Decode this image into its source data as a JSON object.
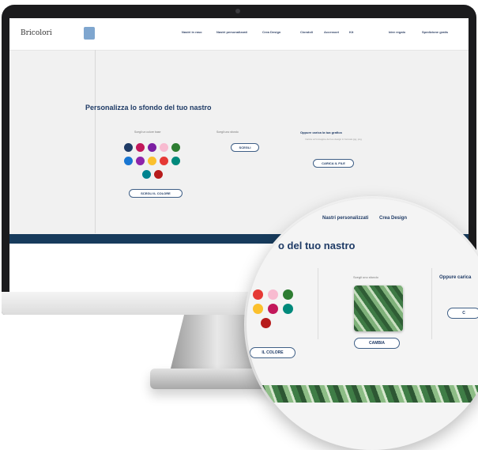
{
  "site": {
    "logo_text": "Bricolori",
    "nav": [
      {
        "label": "Nastri in raso"
      },
      {
        "label": "Nastri personalizzati"
      },
      {
        "label": "Crea Design"
      },
      {
        "label": "Ciondoli"
      },
      {
        "label": "Accessori"
      },
      {
        "label": "Kit"
      },
      {
        "label": "Idee regalo"
      },
      {
        "label": "Spedizione gratis"
      }
    ],
    "section_title": "Personalizza lo sfondo del tuo nastro",
    "col1_label": "Scegli un colore base",
    "col2_label": "Scegli uno sfondo",
    "col3_title": "Oppure carica la tua grafica",
    "col3_note": "Carica un'immagine del tuo design in formato jpg, png",
    "palette": [
      "#1f3b66",
      "#c2185b",
      "#7b1fa2",
      "#f8bbd0",
      "#2e7d32",
      "#1976d2",
      "#8e24aa",
      "#fbc02d",
      "#e53935",
      "#00897b",
      "#00838f",
      "#b71c1c"
    ],
    "button_colore": "SCEGLI IL COLORE",
    "button_sfondo": "SCEGLI",
    "button_carica": "CARICA IL FILE"
  },
  "magnifier": {
    "title_fragment": "o del tuo nastro",
    "nav_fragment_1": "Nastri personalizzati",
    "nav_fragment_2": "Crea Design",
    "col2_label": "Scegli uno sfondo",
    "col3_title": "Oppure carica",
    "palette": [
      "#e53935",
      "#f8bbd0",
      "#2e7d32",
      "#fbc02d",
      "#c2185b",
      "#00897b",
      "#b71c1c"
    ],
    "button_colore": "IL COLORE",
    "button_cambia": "CAMBIA",
    "button_carica": "C"
  }
}
